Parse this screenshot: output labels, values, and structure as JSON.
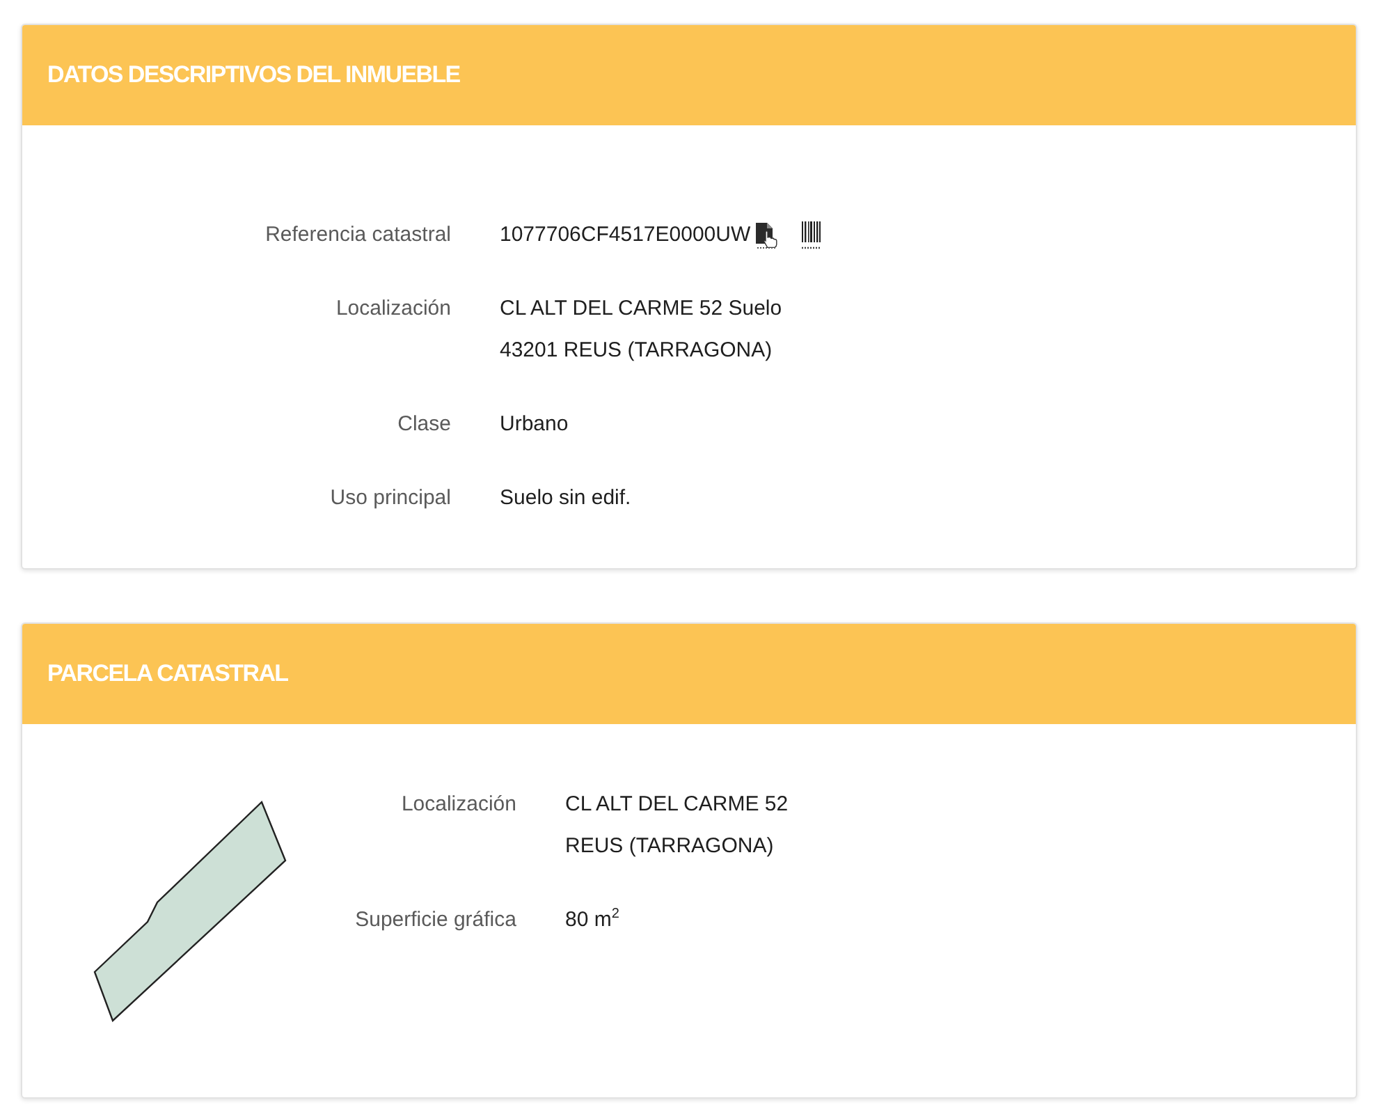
{
  "sections": [
    {
      "title": "DATOS DESCRIPTIVOS DEL INMUEBLE",
      "kind": "fields",
      "fields": [
        {
          "label": "Referencia catastral",
          "kind": "reference",
          "lines": [
            "1077706CF4517E0000UW"
          ]
        },
        {
          "label": "Localización",
          "kind": "text",
          "lines": [
            "CL ALT DEL CARME 52 Suelo",
            "43201 REUS (TARRAGONA)"
          ]
        },
        {
          "label": "Clase",
          "kind": "text",
          "lines": [
            "Urbano"
          ]
        },
        {
          "label": "Uso principal",
          "kind": "text",
          "lines": [
            "Suelo sin edif."
          ]
        }
      ]
    },
    {
      "title": "PARCELA CATASTRAL",
      "kind": "parcel",
      "fields": [
        {
          "label": "Localización",
          "kind": "text",
          "lines": [
            "CL ALT DEL CARME 52",
            "REUS (TARRAGONA)"
          ]
        },
        {
          "label": "Superficie gráfica",
          "kind": "text",
          "lines": [
            "80 m$^{2}$"
          ]
        }
      ]
    }
  ]
}
